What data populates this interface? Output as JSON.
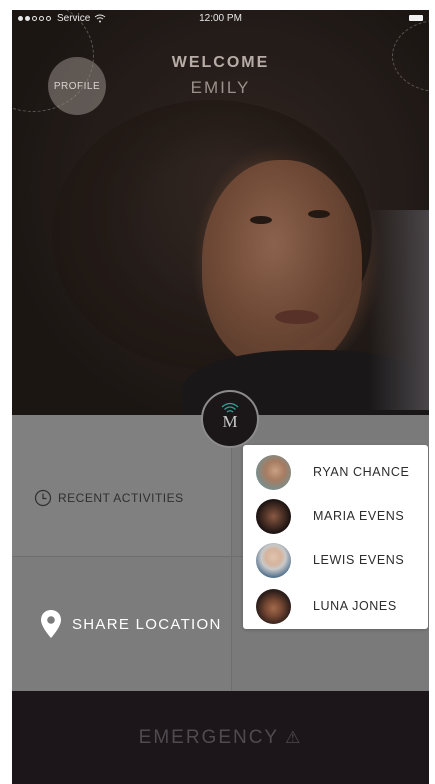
{
  "status_bar": {
    "carrier": "Service",
    "time": "12:00 PM",
    "signal_icon": "signal-dots-icon",
    "wifi_icon": "wifi-icon",
    "battery_icon": "battery-icon"
  },
  "header": {
    "profile_label": "PROFILE",
    "welcome_label": "WELCOME",
    "user_name": "EMILY"
  },
  "center_button": {
    "letter": "M",
    "icon": "signal-waves-icon"
  },
  "tiles": {
    "recent_activities": {
      "label": "RECENT ACTIVITIES",
      "icon": "clock-icon"
    },
    "share_location": {
      "label": "SHARE LOCATION",
      "icon": "location-pin-icon"
    }
  },
  "contacts_popup": {
    "contacts": [
      {
        "name": "RYAN CHANCE"
      },
      {
        "name": "MARIA EVENS"
      },
      {
        "name": "LEWIS EVENS"
      },
      {
        "name": "LUNA JONES"
      }
    ]
  },
  "footer": {
    "emergency_label": "EMERGENCY",
    "warning_icon": "warning-triangle-icon",
    "warning_glyph": "⚠"
  },
  "colors": {
    "emergency_bg": "#1c161b",
    "tile_gray": "#7e7e7e",
    "popup_bg": "#ffffff"
  }
}
